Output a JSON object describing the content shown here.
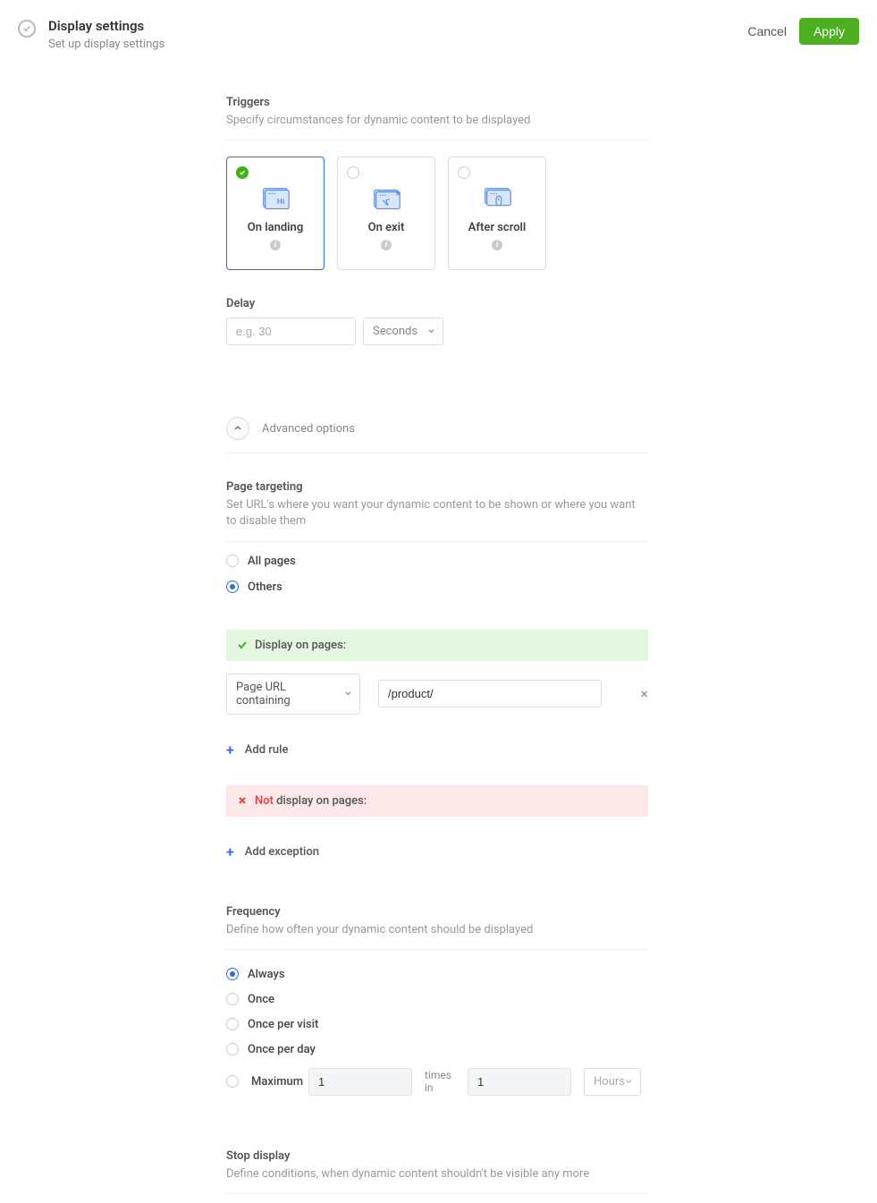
{
  "header": {
    "title": "Display settings",
    "subtitle": "Set up display settings",
    "cancel": "Cancel",
    "apply": "Apply"
  },
  "triggers": {
    "title": "Triggers",
    "subtitle": "Specify circumstances for dynamic content to be displayed",
    "on_landing": "On landing",
    "on_exit": "On exit",
    "after_scroll": "After scroll"
  },
  "delay": {
    "label": "Delay",
    "placeholder": "e.g. 30",
    "unit": "Seconds"
  },
  "advanced": {
    "label": "Advanced options"
  },
  "page_targeting": {
    "title": "Page targeting",
    "subtitle": "Set URL's where you want your dynamic content to be shown or where you want to disable them",
    "all_pages": "All pages",
    "others": "Others",
    "display_on": "Display on pages:",
    "rule_type": "Page URL containing",
    "rule_value": "/product/",
    "add_rule": "Add rule",
    "not": "Not",
    "not_rest": " display on pages:",
    "add_exception": "Add exception"
  },
  "frequency": {
    "title": "Frequency",
    "subtitle": "Define how often your dynamic content should be displayed",
    "always": "Always",
    "once": "Once",
    "once_per_visit": "Once per visit",
    "once_per_day": "Once per day",
    "maximum": "Maximum",
    "max_times_value": "1",
    "times_in": "times in",
    "max_period_value": "1",
    "hours": "Hours"
  },
  "stop": {
    "title": "Stop display",
    "subtitle": "Define conditions, when dynamic content shouldn't be visible any more"
  }
}
